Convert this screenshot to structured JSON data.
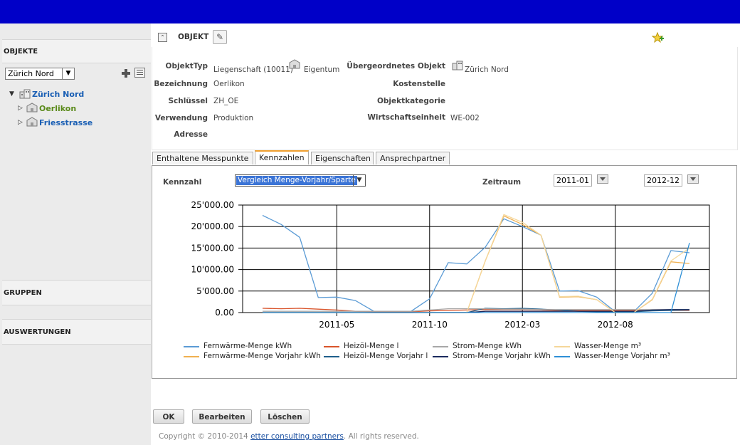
{
  "sidebar": {
    "objekte_label": "OBJEKTE",
    "select_value": "Zürich Nord",
    "tree": [
      {
        "label": "Zürich Nord",
        "color": "#1a5fb4"
      },
      {
        "label": "Oerlikon",
        "color": "#5a8a1a"
      },
      {
        "label": "Friesstrasse",
        "color": "#1a5fb4"
      }
    ],
    "gruppen_label": "GRUPPEN",
    "auswertungen_label": "AUSWERTUNGEN"
  },
  "header": {
    "title": "OBJEKT"
  },
  "details": {
    "objekttyp_label": "ObjektTyp",
    "objekttyp_value": "Liegenschaft (10011)",
    "eigentum_value": "Eigentum",
    "bezeichnung_label": "Bezeichnung",
    "bezeichnung_value": "Oerlikon",
    "schluessel_label": "Schlüssel",
    "schluessel_value": "ZH_OE",
    "verwendung_label": "Verwendung",
    "verwendung_value": "Produktion",
    "adresse_label": "Adresse",
    "uebergeordnet_label": "Übergeordnetes Objekt",
    "uebergeordnet_value": "Zürich Nord",
    "kostenstelle_label": "Kostenstelle",
    "objektkategorie_label": "Objektkategorie",
    "wirtschaftseinheit_label": "Wirtschaftseinheit",
    "wirtschaftseinheit_value": "WE-002"
  },
  "tabs": [
    "Enthaltene Messpunkte",
    "Kennzahlen",
    "Eigenschaften",
    "Ansprechpartner"
  ],
  "kennzahlen": {
    "kennzahl_label": "Kennzahl",
    "kennzahl_value": "Vergleich Menge-Vorjahr/Sparte",
    "zeitraum_label": "Zeitraum",
    "from": "2011-01",
    "to": "2012-12"
  },
  "chart_data": {
    "type": "line",
    "x": [
      "2011-01",
      "2011-02",
      "2011-03",
      "2011-04",
      "2011-05",
      "2011-06",
      "2011-07",
      "2011-08",
      "2011-09",
      "2011-10",
      "2011-11",
      "2011-12",
      "2012-01",
      "2012-02",
      "2012-03",
      "2012-04",
      "2012-05",
      "2012-06",
      "2012-07",
      "2012-08",
      "2012-09",
      "2012-10",
      "2012-11",
      "2012-12"
    ],
    "x_tick_labels": [
      "2011-05",
      "2011-10",
      "2012-03",
      "2012-08"
    ],
    "y_tick_labels": [
      "25'000.00",
      "20'000.00",
      "15'000.00",
      "10'000.00",
      "5'000.00",
      "0.00"
    ],
    "ylim": [
      0,
      25000
    ],
    "grid": true,
    "legend_position": "bottom",
    "series": [
      {
        "name": "Fernwärme-Menge kWh",
        "color": "#5b9bd5",
        "values": [
          22600,
          20500,
          17500,
          3500,
          3600,
          2800,
          300,
          300,
          300,
          3200,
          11600,
          11300,
          15200,
          21800,
          20000,
          18000,
          5000,
          5100,
          3600,
          200,
          200,
          4500,
          14400,
          13900
        ]
      },
      {
        "name": "Fernwärme-Menge Vorjahr kWh",
        "color": "#f0b050",
        "values": [
          0,
          0,
          0,
          0,
          0,
          0,
          0,
          0,
          0,
          0,
          0,
          0,
          12000,
          22500,
          20500,
          18000,
          3600,
          3700,
          3000,
          0,
          0,
          3000,
          11800,
          11400
        ]
      },
      {
        "name": "Heizöl-Menge l",
        "color": "#d9542b",
        "values": [
          1000,
          900,
          1000,
          800,
          600,
          300,
          200,
          200,
          200,
          400,
          500,
          600,
          700,
          700,
          700,
          600,
          500,
          500,
          500,
          500,
          500,
          500,
          500,
          500
        ]
      },
      {
        "name": "Heizöl-Menge Vorjahr l",
        "color": "#1f5f8b",
        "values": [
          0,
          0,
          0,
          0,
          0,
          0,
          0,
          0,
          0,
          0,
          0,
          0,
          1000,
          900,
          1000,
          800,
          600,
          300,
          200,
          200,
          200,
          400,
          500,
          600
        ]
      },
      {
        "name": "Strom-Menge kWh",
        "color": "#a8a8a8",
        "values": [
          300,
          300,
          300,
          300,
          300,
          300,
          300,
          300,
          300,
          600,
          900,
          900,
          900,
          800,
          800,
          700,
          700,
          700,
          700,
          700,
          700,
          700,
          700,
          700
        ]
      },
      {
        "name": "Strom-Menge Vorjahr kWh",
        "color": "#1a2a5e",
        "values": [
          0,
          0,
          0,
          0,
          0,
          0,
          0,
          0,
          0,
          0,
          0,
          0,
          300,
          300,
          300,
          300,
          300,
          300,
          300,
          300,
          300,
          600,
          700,
          700
        ]
      },
      {
        "name": "Wasser-Menge m³",
        "color": "#f5d79a",
        "values": [
          0,
          0,
          0,
          0,
          0,
          0,
          0,
          0,
          0,
          0,
          0,
          0,
          12000,
          22800,
          21000,
          18000,
          3700,
          3800,
          3000,
          0,
          0,
          3100,
          12000,
          15000
        ]
      },
      {
        "name": "Wasser-Menge Vorjahr m³",
        "color": "#2e8fd6",
        "values": [
          0,
          0,
          0,
          0,
          0,
          0,
          0,
          0,
          0,
          0,
          0,
          0,
          0,
          0,
          0,
          0,
          0,
          0,
          0,
          0,
          0,
          0,
          0,
          16200
        ]
      }
    ]
  },
  "buttons": {
    "ok": "OK",
    "bearbeiten": "Bearbeiten",
    "loeschen": "Löschen"
  },
  "footer": {
    "copyright": "Copyright © 2010-2014 ",
    "link": "etter consulting partners",
    "rest": ". All rights reserved."
  }
}
